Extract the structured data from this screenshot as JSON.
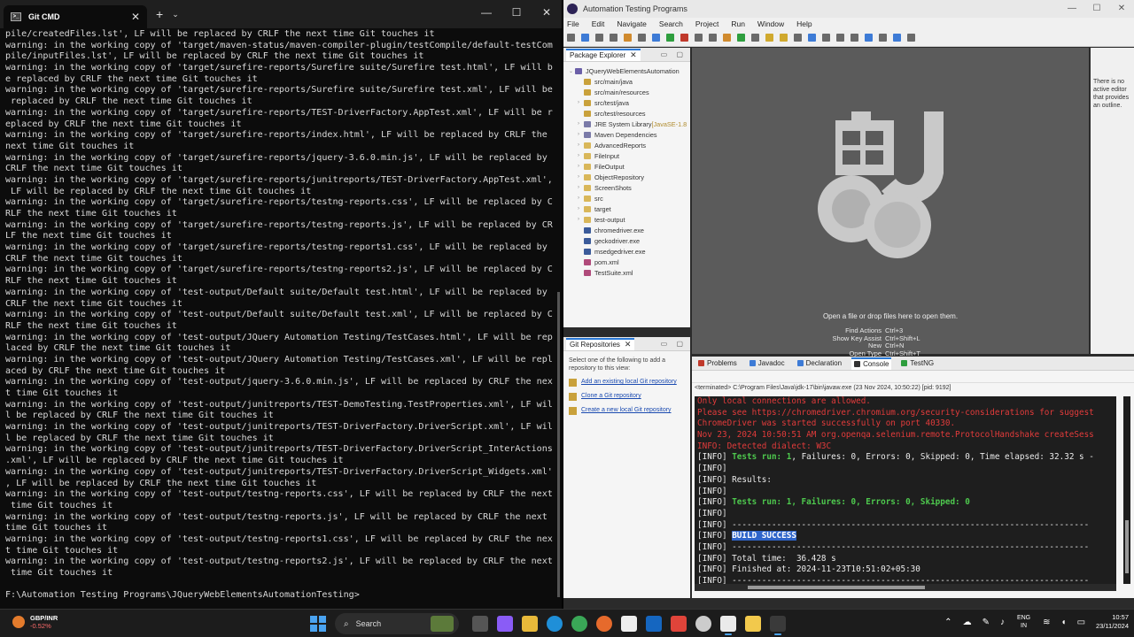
{
  "terminal": {
    "tab_title": "Git CMD",
    "new_tab": "+",
    "dropdown": "⌄",
    "win_min": "—",
    "win_max": "☐",
    "win_close": "✕",
    "lines": [
      "pile/createdFiles.lst', LF will be replaced by CRLF the next time Git touches it",
      "warning: in the working copy of 'target/maven-status/maven-compiler-plugin/testCompile/default-testCom",
      "pile/inputFiles.lst', LF will be replaced by CRLF the next time Git touches it",
      "warning: in the working copy of 'target/surefire-reports/Surefire suite/Surefire test.html', LF will b",
      "e replaced by CRLF the next time Git touches it",
      "warning: in the working copy of 'target/surefire-reports/Surefire suite/Surefire test.xml', LF will be",
      " replaced by CRLF the next time Git touches it",
      "warning: in the working copy of 'target/surefire-reports/TEST-DriverFactory.AppTest.xml', LF will be r",
      "eplaced by CRLF the next time Git touches it",
      "warning: in the working copy of 'target/surefire-reports/index.html', LF will be replaced by CRLF the",
      "next time Git touches it",
      "warning: in the working copy of 'target/surefire-reports/jquery-3.6.0.min.js', LF will be replaced by",
      "CRLF the next time Git touches it",
      "warning: in the working copy of 'target/surefire-reports/junitreports/TEST-DriverFactory.AppTest.xml',",
      " LF will be replaced by CRLF the next time Git touches it",
      "warning: in the working copy of 'target/surefire-reports/testng-reports.css', LF will be replaced by C",
      "RLF the next time Git touches it",
      "warning: in the working copy of 'target/surefire-reports/testng-reports.js', LF will be replaced by CR",
      "LF the next time Git touches it",
      "warning: in the working copy of 'target/surefire-reports/testng-reports1.css', LF will be replaced by",
      "CRLF the next time Git touches it",
      "warning: in the working copy of 'target/surefire-reports/testng-reports2.js', LF will be replaced by C",
      "RLF the next time Git touches it",
      "warning: in the working copy of 'test-output/Default suite/Default test.html', LF will be replaced by",
      "CRLF the next time Git touches it",
      "warning: in the working copy of 'test-output/Default suite/Default test.xml', LF will be replaced by C",
      "RLF the next time Git touches it",
      "warning: in the working copy of 'test-output/JQuery Automation Testing/TestCases.html', LF will be rep",
      "laced by CRLF the next time Git touches it",
      "warning: in the working copy of 'test-output/JQuery Automation Testing/TestCases.xml', LF will be repl",
      "aced by CRLF the next time Git touches it",
      "warning: in the working copy of 'test-output/jquery-3.6.0.min.js', LF will be replaced by CRLF the nex",
      "t time Git touches it",
      "warning: in the working copy of 'test-output/junitreports/TEST-DemoTesting.TestProperties.xml', LF wil",
      "l be replaced by CRLF the next time Git touches it",
      "warning: in the working copy of 'test-output/junitreports/TEST-DriverFactory.DriverScript.xml', LF wil",
      "l be replaced by CRLF the next time Git touches it",
      "warning: in the working copy of 'test-output/junitreports/TEST-DriverFactory.DriverScript_InterActions",
      ".xml', LF will be replaced by CRLF the next time Git touches it",
      "warning: in the working copy of 'test-output/junitreports/TEST-DriverFactory.DriverScript_Widgets.xml'",
      ", LF will be replaced by CRLF the next time Git touches it",
      "warning: in the working copy of 'test-output/testng-reports.css', LF will be replaced by CRLF the next",
      " time Git touches it",
      "warning: in the working copy of 'test-output/testng-reports.js', LF will be replaced by CRLF the next",
      "time Git touches it",
      "warning: in the working copy of 'test-output/testng-reports1.css', LF will be replaced by CRLF the nex",
      "t time Git touches it",
      "warning: in the working copy of 'test-output/testng-reports2.js', LF will be replaced by CRLF the next",
      " time Git touches it",
      "",
      "F:\\Automation Testing Programs\\JQueryWebElementsAutomationTesting>"
    ]
  },
  "eclipse": {
    "title": "Automation Testing Programs",
    "menu": [
      "File",
      "Edit",
      "Navigate",
      "Search",
      "Project",
      "Run",
      "Window",
      "Help"
    ],
    "package_explorer": {
      "title": "Package Explorer",
      "items": [
        {
          "label": "JQueryWebElementsAutomation",
          "extra": "",
          "color": "#6b5fa8",
          "arrow": "⌄"
        },
        {
          "label": "src/main/java",
          "extra": "",
          "color": "#c9a13b",
          "arrow": ""
        },
        {
          "label": "src/main/resources",
          "extra": "",
          "color": "#c9a13b",
          "arrow": ""
        },
        {
          "label": "src/test/java",
          "extra": "",
          "color": "#c9a13b",
          "arrow": "›"
        },
        {
          "label": "src/test/resources",
          "extra": "",
          "color": "#c9a13b",
          "arrow": ""
        },
        {
          "label": "JRE System Library",
          "extra": " [JavaSE-1.8",
          "color": "#7a7aa8",
          "arrow": "›"
        },
        {
          "label": "Maven Dependencies",
          "extra": "",
          "color": "#7a7aa8",
          "arrow": "›"
        },
        {
          "label": "AdvancedReports",
          "extra": "",
          "color": "#d9b75a",
          "arrow": "›"
        },
        {
          "label": "FileInput",
          "extra": "",
          "color": "#d9b75a",
          "arrow": "›"
        },
        {
          "label": "FileOutput",
          "extra": "",
          "color": "#d9b75a",
          "arrow": "›"
        },
        {
          "label": "ObjectRepository",
          "extra": "",
          "color": "#d9b75a",
          "arrow": "›"
        },
        {
          "label": "ScreenShots",
          "extra": "",
          "color": "#d9b75a",
          "arrow": "›"
        },
        {
          "label": "src",
          "extra": "",
          "color": "#d9b75a",
          "arrow": "›"
        },
        {
          "label": "target",
          "extra": "",
          "color": "#d9b75a",
          "arrow": "›"
        },
        {
          "label": "test-output",
          "extra": "",
          "color": "#d9b75a",
          "arrow": "›"
        },
        {
          "label": "chromedriver.exe",
          "extra": "",
          "color": "#3b5b9a",
          "arrow": ""
        },
        {
          "label": "geckodriver.exe",
          "extra": "",
          "color": "#3b5b9a",
          "arrow": ""
        },
        {
          "label": "msedgedriver.exe",
          "extra": "",
          "color": "#3b5b9a",
          "arrow": ""
        },
        {
          "label": "pom.xml",
          "extra": "",
          "color": "#b04a7a",
          "arrow": ""
        },
        {
          "label": "TestSuite.xml",
          "extra": "",
          "color": "#b04a7a",
          "arrow": ""
        }
      ]
    },
    "git_repos": {
      "title": "Git Repositories",
      "hint": "Select one of the following to add a repository to this view:",
      "links": [
        "Add an existing local Git repository",
        "Clone a Git repository",
        "Create a new local Git repository"
      ]
    },
    "editor": {
      "hint": "Open a file or drop files here to open them.",
      "shortcuts": [
        {
          "label": "Find Actions",
          "key": "Ctrl+3"
        },
        {
          "label": "Show Key Assist",
          "key": "Ctrl+Shift+L"
        },
        {
          "label": "New",
          "key": "Ctrl+N"
        },
        {
          "label": "Open Type",
          "key": "Ctrl+Shift+T"
        }
      ]
    },
    "outline_text": "There is no active editor that provides an outline.",
    "console": {
      "tabs": [
        "Problems",
        "Javadoc",
        "Declaration",
        "Console",
        "TestNG"
      ],
      "terminated": "<terminated> C:\\Program Files\\Java\\jdk-17\\bin\\javaw.exe (23 Nov 2024, 10:50:22) [pid: 9192]",
      "lines": [
        {
          "text": "Only local connections are allowed.",
          "style": "red"
        },
        {
          "text": "Please see https://chromedriver.chromium.org/security-considerations for suggest",
          "style": "red"
        },
        {
          "text": "ChromeDriver was started successfully on port 40330.",
          "style": "red"
        },
        {
          "text": "Nov 23, 2024 10:50:51 AM org.openqa.selenium.remote.ProtocolHandshake createSess",
          "style": "red"
        },
        {
          "text": "INFO: Detected dialect: W3C",
          "style": "red"
        },
        {
          "pre": "[INFO] ",
          "text": "Tests run: ",
          "mid": "1",
          "post": ", Failures: 0, Errors: 0, Skipped: 0, Time elapsed: 32.32 s -",
          "style": "mixed"
        },
        {
          "text": "[INFO]",
          "style": "wh"
        },
        {
          "text": "[INFO] Results:",
          "style": "wh"
        },
        {
          "text": "[INFO]",
          "style": "wh"
        },
        {
          "pre": "[INFO] ",
          "text": "Tests run: 1, Failures: 0, Errors: 0, Skipped: 0",
          "style": "grn"
        },
        {
          "text": "[INFO]",
          "style": "wh"
        },
        {
          "text": "[INFO] ------------------------------------------------------------------------",
          "style": "wh"
        },
        {
          "pre": "[INFO] ",
          "text": "BUILD SUCCESS",
          "style": "hl"
        },
        {
          "text": "[INFO] ------------------------------------------------------------------------",
          "style": "wh"
        },
        {
          "text": "[INFO] Total time:  36.428 s",
          "style": "wh"
        },
        {
          "text": "[INFO] Finished at: 2024-11-23T10:51:02+05:30",
          "style": "wh"
        },
        {
          "text": "[INFO] ------------------------------------------------------------------------",
          "style": "wh"
        }
      ]
    }
  },
  "taskbar": {
    "stock_name": "GBP/INR",
    "stock_change": "-0.52%",
    "search_placeholder": "Search",
    "lang_top": "ENG",
    "lang_bottom": "IN",
    "time": "10:57",
    "date": "23/11/2024",
    "apps": [
      {
        "name": "task-view-app",
        "color": "#555"
      },
      {
        "name": "copilot-app",
        "color": "#8a5cf6"
      },
      {
        "name": "file-explorer-app",
        "color": "#e8b93a"
      },
      {
        "name": "edge-app",
        "color": "#1f8fd8"
      },
      {
        "name": "chrome-app",
        "color": "#3aa757"
      },
      {
        "name": "firefox-app",
        "color": "#e66a2c"
      },
      {
        "name": "store-app",
        "color": "#eeeeee"
      },
      {
        "name": "outlook-app",
        "color": "#1566c0"
      },
      {
        "name": "podcast-app",
        "color": "#e0443a"
      },
      {
        "name": "chatgpt-app",
        "color": "#cccccc"
      },
      {
        "name": "calculator-app",
        "color": "#eaeaea"
      },
      {
        "name": "notes-app",
        "color": "#f2c94c"
      },
      {
        "name": "terminal-app",
        "color": "#3a3a3a"
      }
    ]
  }
}
